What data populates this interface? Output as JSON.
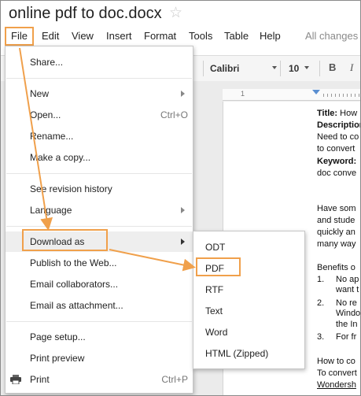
{
  "document": {
    "title": "online pdf to doc.docx"
  },
  "menubar": {
    "items": [
      "File",
      "Edit",
      "View",
      "Insert",
      "Format",
      "Tools",
      "Table",
      "Help"
    ],
    "status": "All changes"
  },
  "toolbar": {
    "font": "Calibri",
    "size": "10",
    "bold": "B",
    "italic": "I"
  },
  "ruler": {
    "number": "1"
  },
  "file_menu": {
    "share": "Share...",
    "new": "New",
    "open": "Open...",
    "open_shortcut": "Ctrl+O",
    "rename": "Rename...",
    "copy": "Make a copy...",
    "revision": "See revision history",
    "language": "Language",
    "download": "Download as",
    "publish": "Publish to the Web...",
    "email_collab": "Email collaborators...",
    "email_attach": "Email as attachment...",
    "page_setup": "Page setup...",
    "print_preview": "Print preview",
    "print": "Print",
    "print_shortcut": "Ctrl+P"
  },
  "download_menu": {
    "items": [
      "ODT",
      "PDF",
      "RTF",
      "Text",
      "Word",
      "HTML (Zipped)"
    ]
  },
  "page": {
    "title_label": "Title:",
    "title_value": " How",
    "description_label": "Description",
    "line_need": "Need to co",
    "line_convert": "to convert",
    "keyword_label": "Keyword:",
    "line_doc": "doc conve",
    "line_have": "Have som",
    "line_stude": "and stude",
    "line_quick": "quickly an",
    "line_many": "many way",
    "line_benefits": "Benefits o",
    "li1_num": "1.",
    "li1_a": "No ap",
    "li1_b": "want t",
    "li2_num": "2.",
    "li2_a": "No re",
    "li2_b": "Windo",
    "li2_c": "the In",
    "li3_num": "3.",
    "li3_a": "For fr",
    "line_howto": "How to co",
    "line_toconv": "To convert",
    "line_wonder": "Wondersh"
  }
}
